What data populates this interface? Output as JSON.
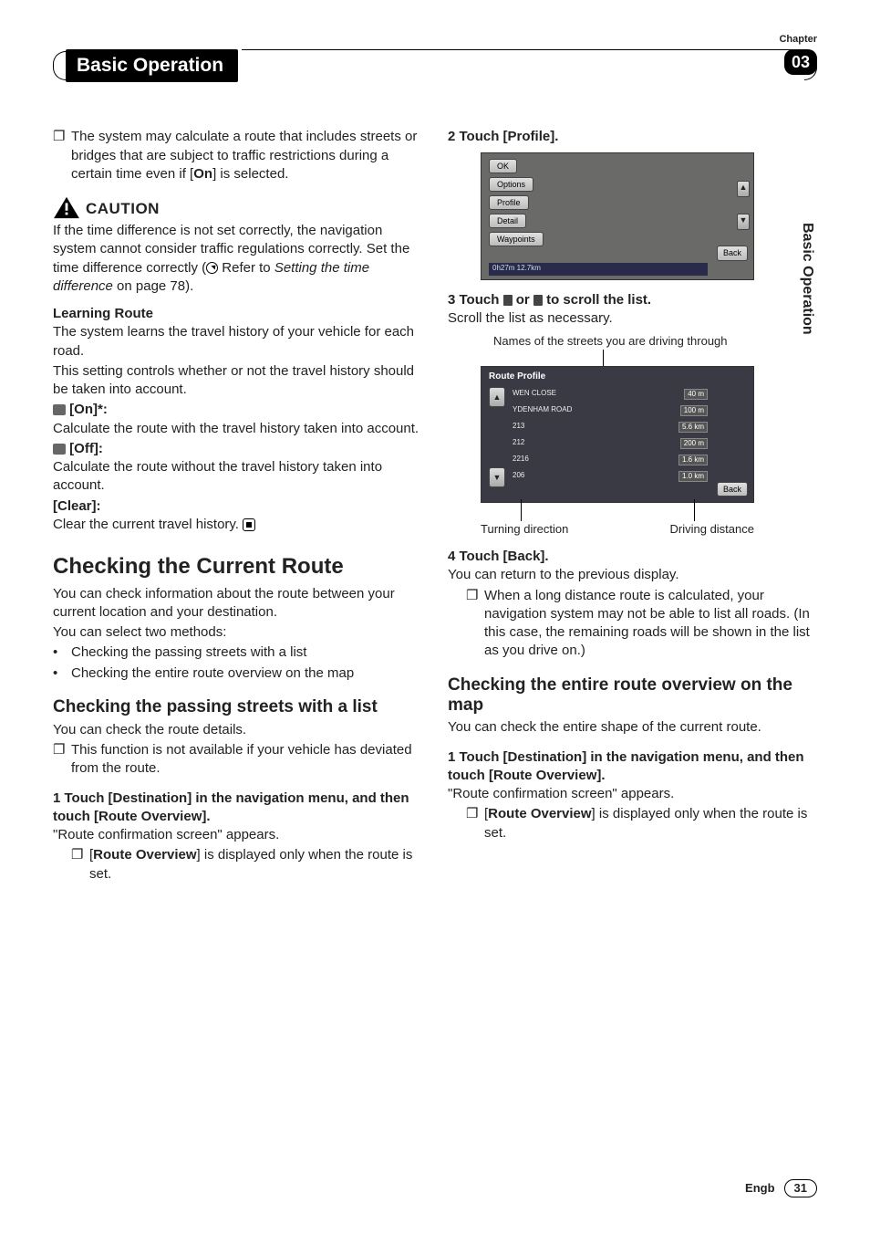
{
  "chapter_label": "Chapter",
  "chapter_number": "03",
  "header_title": "Basic Operation",
  "side_label": "Basic Operation",
  "left": {
    "note1": "The system may calculate a route that includes streets or bridges that are subject to traffic restrictions during a certain time even if [",
    "note1_bold": "On",
    "note1_tail": "] is selected.",
    "caution_label": "CAUTION",
    "caution_body1": "If the time difference is not set correctly, the navigation system cannot consider traffic regulations correctly. Set the time difference correctly (",
    "caution_body2": "Refer to ",
    "caution_body2_ital": "Setting the time difference",
    "caution_body2_tail": " on page 78).",
    "learning_heading": "Learning Route",
    "learning_p1": "The system learns the travel history of your vehicle for each road.",
    "learning_p2": "This setting controls whether or not the travel history should be taken into account.",
    "on_label": "[On]*:",
    "on_body": "Calculate the route with the travel history taken into account.",
    "off_label": "[Off]:",
    "off_body": "Calculate the route without the travel history taken into account.",
    "clear_label": "[Clear]:",
    "clear_body": "Clear the current travel history.",
    "section_heading": "Checking the Current Route",
    "section_p1": "You can check information about the route between your current location and your destination.",
    "section_p2": "You can select two methods:",
    "method1": "Checking the passing streets with a list",
    "method2": "Checking the entire route overview on the map",
    "sub1_heading": "Checking the passing streets with a list",
    "sub1_p1": "You can check the route details.",
    "sub1_note": "This function is not available if your vehicle has deviated from the route.",
    "step1_label": "1    Touch [Destination] in the navigation menu, and then touch [Route Overview].",
    "step1_p": "\"Route confirmation screen\" appears.",
    "step1_note_pre": "[",
    "step1_note_bold": "Route Overview",
    "step1_note_tail": "] is displayed only when the route is set."
  },
  "right": {
    "step2_label": "2    Touch [Profile].",
    "map_menu": {
      "ok": "OK",
      "options": "Options",
      "profile": "Profile",
      "detail": "Detail",
      "waypoints": "Waypoints",
      "back": "Back",
      "status": "0h27m   12.7km"
    },
    "step3_label_pre": "3    Touch ",
    "step3_label_mid": " or ",
    "step3_label_tail": " to scroll the list.",
    "step3_p": "Scroll the list as necessary.",
    "top_caption": "Names of the streets you are driving through",
    "profile": {
      "title": "Route Profile",
      "rows": [
        {
          "name": "WEN CLOSE",
          "dist": "40 m"
        },
        {
          "name": "YDENHAM ROAD",
          "dist": "100 m"
        },
        {
          "name": "213",
          "dist": "5.6 km"
        },
        {
          "name": "212",
          "dist": "200 m"
        },
        {
          "name": "2216",
          "dist": "1.6 km"
        },
        {
          "name": "206",
          "dist": "1.0 km"
        }
      ],
      "back": "Back"
    },
    "cap_left": "Turning direction",
    "cap_right": "Driving distance",
    "step4_label": "4    Touch [Back].",
    "step4_p": "You can return to the previous display.",
    "step4_note": "When a long distance route is calculated, your navigation system may not be able to list all roads. (In this case, the remaining roads will be shown in the list as you drive on.)",
    "sub2_heading": "Checking the entire route overview on the map",
    "sub2_p": "You can check the entire shape of the current route.",
    "sub2_step1": "1    Touch [Destination] in the navigation menu, and then touch [Route Overview].",
    "sub2_step1_p": "\"Route confirmation screen\" appears.",
    "sub2_note_pre": "[",
    "sub2_note_bold": "Route Overview",
    "sub2_note_tail": "] is displayed only when the route is set."
  },
  "footer": {
    "lang": "Engb",
    "page": "31"
  }
}
